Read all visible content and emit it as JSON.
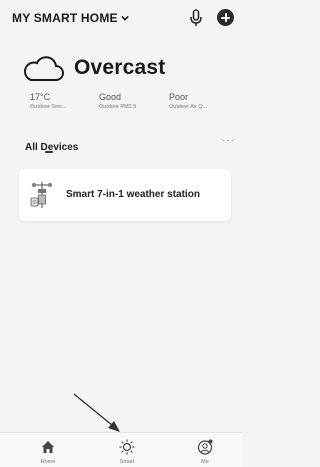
{
  "header": {
    "home_title": "MY SMART HOME",
    "icons": [
      "chevron-down-icon",
      "microphone-icon",
      "add-icon"
    ]
  },
  "weather": {
    "condition": "Overcast",
    "icon": "cloud-icon",
    "stats": [
      {
        "value": "17°C",
        "label": "Outdoor Tem..."
      },
      {
        "value": "Good",
        "label": "Outdoor PM2.5"
      },
      {
        "value": "Poor",
        "label": "Outdoor Air Q..."
      }
    ]
  },
  "devices": {
    "section_title": "All Devices",
    "more_label": "···",
    "items": [
      {
        "name": "Smart 7-in-1 weather station",
        "icon": "weather-station-icon"
      }
    ]
  },
  "navbar": {
    "items": [
      {
        "label": "Home",
        "icon": "home-icon"
      },
      {
        "label": "Smart",
        "icon": "sun-icon"
      },
      {
        "label": "Me",
        "icon": "person-icon"
      }
    ]
  },
  "colors": {
    "background": "#f4f4f4",
    "card": "#ffffff",
    "text": "#1a1a1a",
    "muted": "#777777"
  }
}
